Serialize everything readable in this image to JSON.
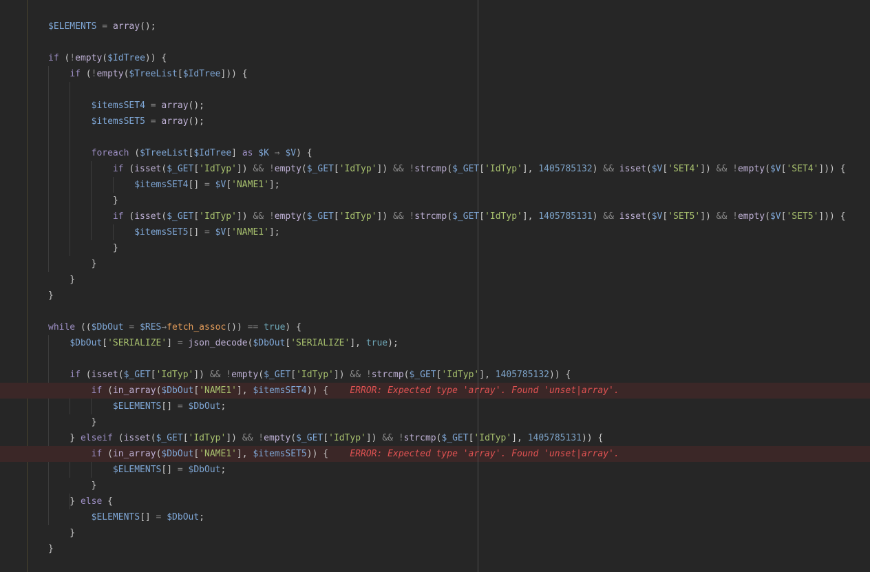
{
  "editor": {
    "language": "PHP",
    "lines": [
      [
        [
          "var",
          "$ELEMENTS"
        ],
        [
          "op",
          " = "
        ],
        [
          "fn",
          "array"
        ],
        [
          "p",
          "();"
        ]
      ],
      [],
      [
        [
          "kw",
          "if"
        ],
        [
          "p",
          " ("
        ],
        [
          "op",
          "!"
        ],
        [
          "fn",
          "empty"
        ],
        [
          "p",
          "("
        ],
        [
          "var",
          "$IdTree"
        ],
        [
          "p",
          ")) {"
        ]
      ],
      [
        [
          "p",
          "    "
        ],
        [
          "kw",
          "if"
        ],
        [
          "p",
          " ("
        ],
        [
          "op",
          "!"
        ],
        [
          "fn",
          "empty"
        ],
        [
          "p",
          "("
        ],
        [
          "var",
          "$TreeList"
        ],
        [
          "p",
          "["
        ],
        [
          "var",
          "$IdTree"
        ],
        [
          "p",
          "])) {"
        ]
      ],
      [],
      [
        [
          "p",
          "        "
        ],
        [
          "var",
          "$itemsSET4"
        ],
        [
          "op",
          " = "
        ],
        [
          "fn",
          "array"
        ],
        [
          "p",
          "();"
        ]
      ],
      [
        [
          "p",
          "        "
        ],
        [
          "var",
          "$itemsSET5"
        ],
        [
          "op",
          " = "
        ],
        [
          "fn",
          "array"
        ],
        [
          "p",
          "();"
        ]
      ],
      [],
      [
        [
          "p",
          "        "
        ],
        [
          "kw",
          "foreach"
        ],
        [
          "p",
          " ("
        ],
        [
          "var",
          "$TreeList"
        ],
        [
          "p",
          "["
        ],
        [
          "var",
          "$IdTree"
        ],
        [
          "p",
          "] "
        ],
        [
          "kw",
          "as"
        ],
        [
          "p",
          " "
        ],
        [
          "var",
          "$K"
        ],
        [
          "op",
          " ⇒ "
        ],
        [
          "var",
          "$V"
        ],
        [
          "p",
          ") {"
        ]
      ],
      [
        [
          "p",
          "            "
        ],
        [
          "kw",
          "if"
        ],
        [
          "p",
          " ("
        ],
        [
          "fn",
          "isset"
        ],
        [
          "p",
          "("
        ],
        [
          "var",
          "$_GET"
        ],
        [
          "p",
          "["
        ],
        [
          "str",
          "'IdTyp'"
        ],
        [
          "p",
          "]) "
        ],
        [
          "op",
          "&&"
        ],
        [
          "p",
          " "
        ],
        [
          "op",
          "!"
        ],
        [
          "fn",
          "empty"
        ],
        [
          "p",
          "("
        ],
        [
          "var",
          "$_GET"
        ],
        [
          "p",
          "["
        ],
        [
          "str",
          "'IdTyp'"
        ],
        [
          "p",
          "]) "
        ],
        [
          "op",
          "&&"
        ],
        [
          "p",
          " "
        ],
        [
          "op",
          "!"
        ],
        [
          "fn",
          "strcmp"
        ],
        [
          "p",
          "("
        ],
        [
          "var",
          "$_GET"
        ],
        [
          "p",
          "["
        ],
        [
          "str",
          "'IdTyp'"
        ],
        [
          "p",
          "], "
        ],
        [
          "num",
          "1405785132"
        ],
        [
          "p",
          ") "
        ],
        [
          "op",
          "&&"
        ],
        [
          "p",
          " "
        ],
        [
          "fn",
          "isset"
        ],
        [
          "p",
          "("
        ],
        [
          "var",
          "$V"
        ],
        [
          "p",
          "["
        ],
        [
          "str",
          "'SET4'"
        ],
        [
          "p",
          "]) "
        ],
        [
          "op",
          "&&"
        ],
        [
          "p",
          " "
        ],
        [
          "op",
          "!"
        ],
        [
          "fn",
          "empty"
        ],
        [
          "p",
          "("
        ],
        [
          "var",
          "$V"
        ],
        [
          "p",
          "["
        ],
        [
          "str",
          "'SET4'"
        ],
        [
          "p",
          "])) {"
        ]
      ],
      [
        [
          "p",
          "                "
        ],
        [
          "var",
          "$itemsSET4"
        ],
        [
          "p",
          "[]"
        ],
        [
          "op",
          " = "
        ],
        [
          "var",
          "$V"
        ],
        [
          "p",
          "["
        ],
        [
          "str",
          "'NAME1'"
        ],
        [
          "p",
          "];"
        ]
      ],
      [
        [
          "p",
          "            }"
        ]
      ],
      [
        [
          "p",
          "            "
        ],
        [
          "kw",
          "if"
        ],
        [
          "p",
          " ("
        ],
        [
          "fn",
          "isset"
        ],
        [
          "p",
          "("
        ],
        [
          "var",
          "$_GET"
        ],
        [
          "p",
          "["
        ],
        [
          "str",
          "'IdTyp'"
        ],
        [
          "p",
          "]) "
        ],
        [
          "op",
          "&&"
        ],
        [
          "p",
          " "
        ],
        [
          "op",
          "!"
        ],
        [
          "fn",
          "empty"
        ],
        [
          "p",
          "("
        ],
        [
          "var",
          "$_GET"
        ],
        [
          "p",
          "["
        ],
        [
          "str",
          "'IdTyp'"
        ],
        [
          "p",
          "]) "
        ],
        [
          "op",
          "&&"
        ],
        [
          "p",
          " "
        ],
        [
          "op",
          "!"
        ],
        [
          "fn",
          "strcmp"
        ],
        [
          "p",
          "("
        ],
        [
          "var",
          "$_GET"
        ],
        [
          "p",
          "["
        ],
        [
          "str",
          "'IdTyp'"
        ],
        [
          "p",
          "], "
        ],
        [
          "num",
          "1405785131"
        ],
        [
          "p",
          ") "
        ],
        [
          "op",
          "&&"
        ],
        [
          "p",
          " "
        ],
        [
          "fn",
          "isset"
        ],
        [
          "p",
          "("
        ],
        [
          "var",
          "$V"
        ],
        [
          "p",
          "["
        ],
        [
          "str",
          "'SET5'"
        ],
        [
          "p",
          "]) "
        ],
        [
          "op",
          "&&"
        ],
        [
          "p",
          " "
        ],
        [
          "op",
          "!"
        ],
        [
          "fn",
          "empty"
        ],
        [
          "p",
          "("
        ],
        [
          "var",
          "$V"
        ],
        [
          "p",
          "["
        ],
        [
          "str",
          "'SET5'"
        ],
        [
          "p",
          "])) {"
        ]
      ],
      [
        [
          "p",
          "                "
        ],
        [
          "var",
          "$itemsSET5"
        ],
        [
          "p",
          "[]"
        ],
        [
          "op",
          " = "
        ],
        [
          "var",
          "$V"
        ],
        [
          "p",
          "["
        ],
        [
          "str",
          "'NAME1'"
        ],
        [
          "p",
          "];"
        ]
      ],
      [
        [
          "p",
          "            }"
        ]
      ],
      [
        [
          "p",
          "        }"
        ]
      ],
      [
        [
          "p",
          "    }"
        ]
      ],
      [
        [
          "p",
          "}"
        ]
      ],
      [],
      [
        [
          "kw",
          "while"
        ],
        [
          "p",
          " (("
        ],
        [
          "var",
          "$DbOut"
        ],
        [
          "op",
          " = "
        ],
        [
          "var",
          "$RES"
        ],
        [
          "op",
          "→"
        ],
        [
          "meth",
          "fetch_assoc"
        ],
        [
          "p",
          "()) "
        ],
        [
          "op",
          "=="
        ],
        [
          "p",
          " "
        ],
        [
          "bool",
          "true"
        ],
        [
          "p",
          ") {"
        ]
      ],
      [
        [
          "p",
          "    "
        ],
        [
          "var",
          "$DbOut"
        ],
        [
          "p",
          "["
        ],
        [
          "str",
          "'SERIALIZE'"
        ],
        [
          "p",
          "]"
        ],
        [
          "op",
          " = "
        ],
        [
          "fn",
          "json_decode"
        ],
        [
          "p",
          "("
        ],
        [
          "var",
          "$DbOut"
        ],
        [
          "p",
          "["
        ],
        [
          "str",
          "'SERIALIZE'"
        ],
        [
          "p",
          "], "
        ],
        [
          "bool",
          "true"
        ],
        [
          "p",
          ");"
        ]
      ],
      [],
      [
        [
          "p",
          "    "
        ],
        [
          "kw",
          "if"
        ],
        [
          "p",
          " ("
        ],
        [
          "fn",
          "isset"
        ],
        [
          "p",
          "("
        ],
        [
          "var",
          "$_GET"
        ],
        [
          "p",
          "["
        ],
        [
          "str",
          "'IdTyp'"
        ],
        [
          "p",
          "]) "
        ],
        [
          "op",
          "&&"
        ],
        [
          "p",
          " "
        ],
        [
          "op",
          "!"
        ],
        [
          "fn",
          "empty"
        ],
        [
          "p",
          "("
        ],
        [
          "var",
          "$_GET"
        ],
        [
          "p",
          "["
        ],
        [
          "str",
          "'IdTyp'"
        ],
        [
          "p",
          "]) "
        ],
        [
          "op",
          "&&"
        ],
        [
          "p",
          " "
        ],
        [
          "op",
          "!"
        ],
        [
          "fn",
          "strcmp"
        ],
        [
          "p",
          "("
        ],
        [
          "var",
          "$_GET"
        ],
        [
          "p",
          "["
        ],
        [
          "str",
          "'IdTyp'"
        ],
        [
          "p",
          "], "
        ],
        [
          "num",
          "1405785132"
        ],
        [
          "p",
          ")) {"
        ]
      ],
      [
        [
          "p",
          "        "
        ],
        [
          "kw",
          "if"
        ],
        [
          "p",
          " ("
        ],
        [
          "fn",
          "in_array"
        ],
        [
          "p",
          "("
        ],
        [
          "var",
          "$DbOut"
        ],
        [
          "p",
          "["
        ],
        [
          "str",
          "'NAME1'"
        ],
        [
          "p",
          "], "
        ],
        [
          "var",
          "$itemsSET4"
        ],
        [
          "p",
          ")) {"
        ],
        [
          "p",
          "    "
        ],
        [
          "err",
          "ERROR: Expected type 'array'. Found 'unset|array'."
        ]
      ],
      [
        [
          "p",
          "            "
        ],
        [
          "var",
          "$ELEMENTS"
        ],
        [
          "p",
          "[]"
        ],
        [
          "op",
          " = "
        ],
        [
          "var",
          "$DbOut"
        ],
        [
          "p",
          ";"
        ]
      ],
      [
        [
          "p",
          "        }"
        ]
      ],
      [
        [
          "p",
          "    } "
        ],
        [
          "kw",
          "elseif"
        ],
        [
          "p",
          " ("
        ],
        [
          "fn",
          "isset"
        ],
        [
          "p",
          "("
        ],
        [
          "var",
          "$_GET"
        ],
        [
          "p",
          "["
        ],
        [
          "str",
          "'IdTyp'"
        ],
        [
          "p",
          "]) "
        ],
        [
          "op",
          "&&"
        ],
        [
          "p",
          " "
        ],
        [
          "op",
          "!"
        ],
        [
          "fn",
          "empty"
        ],
        [
          "p",
          "("
        ],
        [
          "var",
          "$_GET"
        ],
        [
          "p",
          "["
        ],
        [
          "str",
          "'IdTyp'"
        ],
        [
          "p",
          "]) "
        ],
        [
          "op",
          "&&"
        ],
        [
          "p",
          " "
        ],
        [
          "op",
          "!"
        ],
        [
          "fn",
          "strcmp"
        ],
        [
          "p",
          "("
        ],
        [
          "var",
          "$_GET"
        ],
        [
          "p",
          "["
        ],
        [
          "str",
          "'IdTyp'"
        ],
        [
          "p",
          "], "
        ],
        [
          "num",
          "1405785131"
        ],
        [
          "p",
          ")) {"
        ]
      ],
      [
        [
          "p",
          "        "
        ],
        [
          "kw",
          "if"
        ],
        [
          "p",
          " ("
        ],
        [
          "fn",
          "in_array"
        ],
        [
          "p",
          "("
        ],
        [
          "var",
          "$DbOut"
        ],
        [
          "p",
          "["
        ],
        [
          "str",
          "'NAME1'"
        ],
        [
          "p",
          "], "
        ],
        [
          "var",
          "$itemsSET5"
        ],
        [
          "p",
          ")) {"
        ],
        [
          "p",
          "    "
        ],
        [
          "err",
          "ERROR: Expected type 'array'. Found 'unset|array'."
        ]
      ],
      [
        [
          "p",
          "            "
        ],
        [
          "var",
          "$ELEMENTS"
        ],
        [
          "p",
          "[]"
        ],
        [
          "op",
          " = "
        ],
        [
          "var",
          "$DbOut"
        ],
        [
          "p",
          ";"
        ]
      ],
      [
        [
          "p",
          "        }"
        ]
      ],
      [
        [
          "p",
          "    } "
        ],
        [
          "kw",
          "else"
        ],
        [
          "p",
          " {"
        ]
      ],
      [
        [
          "p",
          "        "
        ],
        [
          "var",
          "$ELEMENTS"
        ],
        [
          "p",
          "[]"
        ],
        [
          "op",
          " = "
        ],
        [
          "var",
          "$DbOut"
        ],
        [
          "p",
          ";"
        ]
      ],
      [
        [
          "p",
          "    }"
        ]
      ],
      [
        [
          "p",
          "}"
        ]
      ]
    ],
    "error_lines": [
      23,
      27
    ]
  },
  "colors": {
    "background": "#262626",
    "variable": "#7fa7d6",
    "string": "#a8c16e",
    "keyword": "#9d8fc4",
    "error": "#e05252",
    "error_line_bg": "#3b2727"
  }
}
